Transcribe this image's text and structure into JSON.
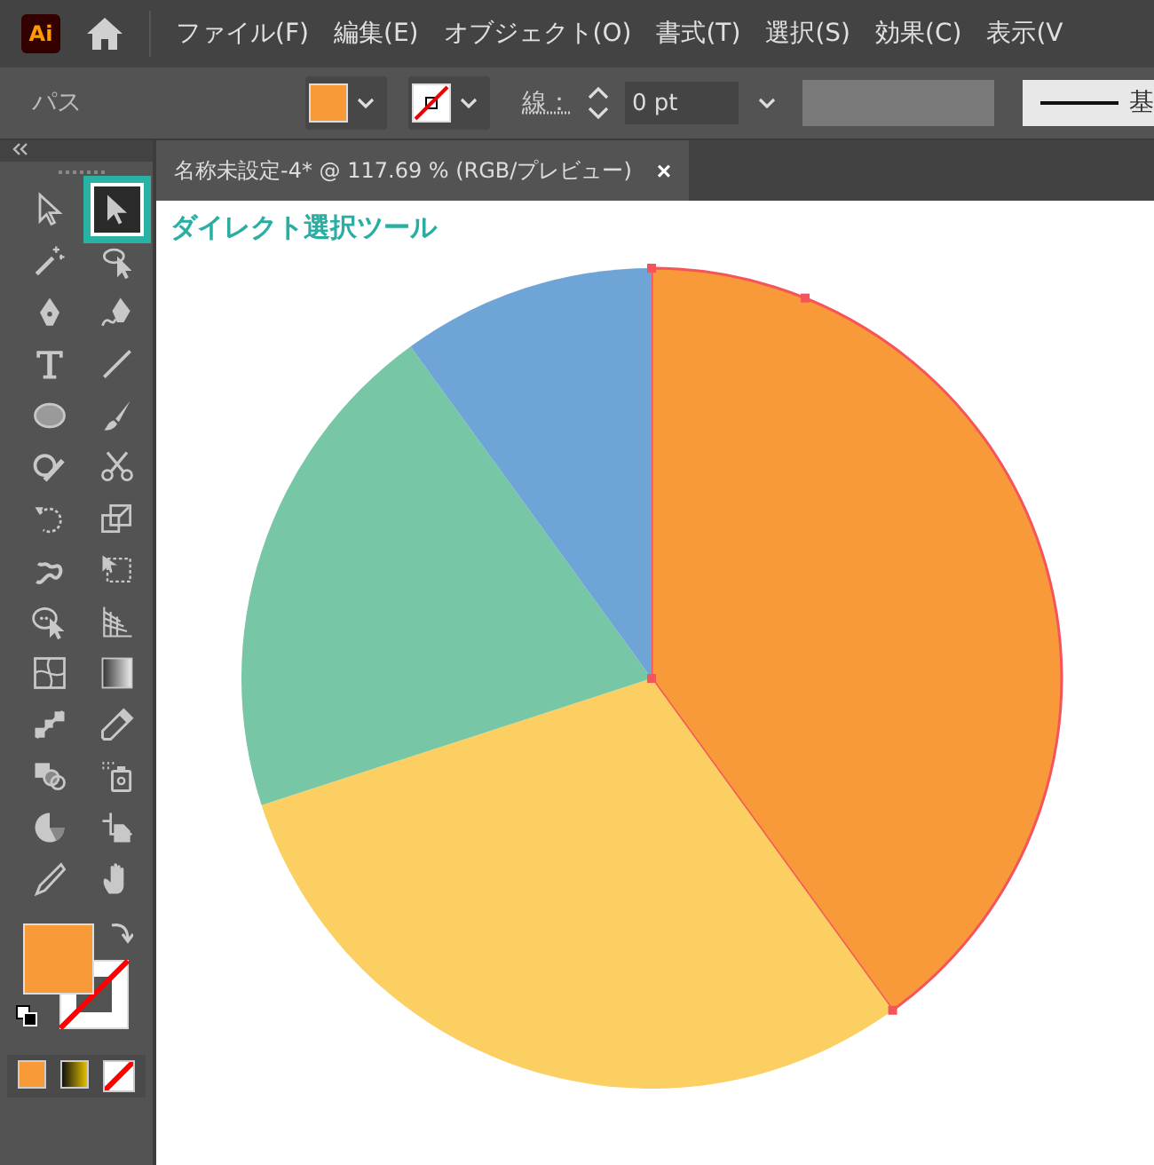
{
  "app": {
    "logo": "Ai"
  },
  "menu": [
    "ファイル(F)",
    "編集(E)",
    "オブジェクト(O)",
    "書式(T)",
    "選択(S)",
    "効果(C)",
    "表示(V"
  ],
  "control_bar": {
    "label": "パス",
    "stroke_label": "線：",
    "stroke_value": "0 pt",
    "style_preview": "基"
  },
  "document_tab": {
    "title": "名称未設定-4* @ 117.69 % (RGB/プレビュー)",
    "close": "×"
  },
  "tools": [
    {
      "selected": false
    },
    {
      "selected": true
    },
    {
      "selected": false
    },
    {
      "selected": false
    },
    {
      "selected": false
    },
    {
      "selected": false
    },
    {
      "selected": false
    },
    {
      "selected": false
    },
    {
      "selected": false
    },
    {
      "selected": false
    },
    {
      "selected": false
    },
    {
      "selected": false
    },
    {
      "selected": false
    },
    {
      "selected": false
    },
    {
      "selected": false
    },
    {
      "selected": false
    },
    {
      "selected": false
    },
    {
      "selected": false
    },
    {
      "selected": false
    },
    {
      "selected": false
    },
    {
      "selected": false
    },
    {
      "selected": false
    },
    {
      "selected": false
    },
    {
      "selected": false
    },
    {
      "selected": false
    },
    {
      "selected": false
    },
    {
      "selected": false
    },
    {
      "selected": false
    }
  ],
  "callout": "ダイレクト選択ツール",
  "slices": [
    {
      "color": "#f89a3a",
      "selected": true
    },
    {
      "color": "#fbcf62",
      "selected": false
    },
    {
      "color": "#77c6a6",
      "selected": false
    },
    {
      "color": "#6fa5d6",
      "selected": false
    }
  ]
}
